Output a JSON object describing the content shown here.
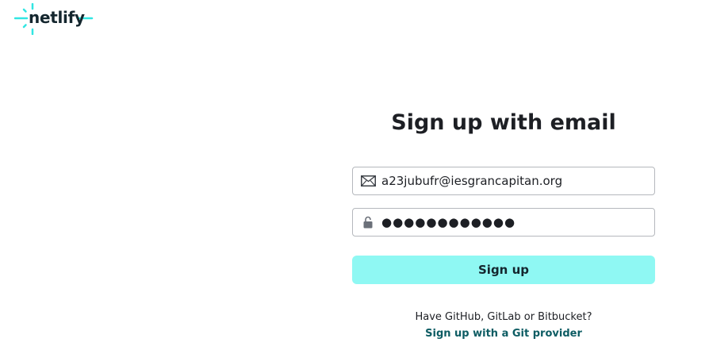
{
  "brand": {
    "name": "netlify",
    "accent_color": "#32e6e2"
  },
  "form": {
    "title": "Sign up with email",
    "email": {
      "value": "a23jubufr@iesgrancapitan.org",
      "icon": "envelope-icon"
    },
    "password": {
      "masked_value": "●●●●●●●●●●●●",
      "icon": "lock-icon"
    },
    "submit_label": "Sign up",
    "submit_color": "#8ff8f3"
  },
  "git": {
    "question": "Have GitHub, GitLab or Bitbucket?",
    "link_label": "Sign up with a Git provider"
  }
}
